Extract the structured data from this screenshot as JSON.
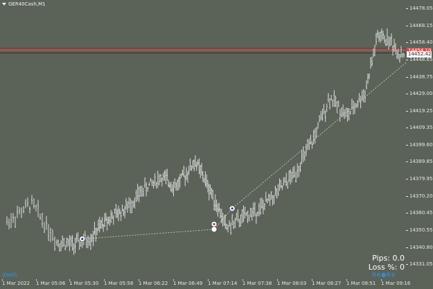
{
  "symbol": "GER40Cash,M1",
  "colors": {
    "background": "#5b6359",
    "candle": "#e9e9e9",
    "bid_line": "#aa1f1f",
    "ask_line": "#e25050",
    "current_line": "#2a2f2a",
    "trend": "#d0d6cc",
    "brand": "#2d8fe0"
  },
  "y_axis": {
    "ticks": [
      "14478.05",
      "14468.15",
      "14458.40",
      "14448.65",
      "14438.75",
      "14429.00",
      "14419.25",
      "14409.35",
      "14399.60",
      "14389.85",
      "14379.95",
      "14370.20",
      "14360.45",
      "14350.55",
      "14340.80",
      "14331.05"
    ]
  },
  "x_axis": {
    "ticks": [
      "1 Mar 2022",
      "1 Mar 05:06",
      "1 Mar 05:30",
      "1 Mar 05:58",
      "1 Mar 06:22",
      "1 Mar 06:49",
      "1 Mar 07:14",
      "1 Mar 07:38",
      "1 Mar 08:03",
      "1 Mar 08:27",
      "1 Mar 08:51",
      "1 Mar 09:16"
    ]
  },
  "price_tags": {
    "ask": "14454.10",
    "current": "14452.42"
  },
  "stats": {
    "pips": "Pips: 0.0",
    "loss": "Loss %: 0"
  },
  "brand": {
    "left": "dweb",
    "right": "Ⅲ⊕●Ⅲ⊉"
  },
  "chart_data": {
    "type": "bar",
    "title": "GER40Cash,M1",
    "ylim": [
      14331.05,
      14478.05
    ],
    "price_levels": [
      14454.1,
      14452.42
    ],
    "markers": [
      {
        "x": "1 Mar 05:24",
        "y": 14345.5
      },
      {
        "x": "1 Mar 07:04",
        "y": 14354.0
      },
      {
        "x": "1 Mar 07:04",
        "y": 14351.0
      },
      {
        "x": "1 Mar 07:18",
        "y": 14363.0
      },
      {
        "x": "1 Mar 09:23",
        "y": 14448.5
      }
    ],
    "trend_path": [
      {
        "x": "1 Mar 05:24",
        "y": 14345.5
      },
      {
        "x": "1 Mar 07:04",
        "y": 14351.0
      },
      {
        "x": "1 Mar 07:18",
        "y": 14363.0
      },
      {
        "x": "1 Mar 09:23",
        "y": 14448.5
      }
    ],
    "series": [
      {
        "x": [
          "1 Mar 2022",
          "1 Mar 05:06",
          "1 Mar 05:30",
          "1 Mar 05:58",
          "1 Mar 06:22",
          "1 Mar 06:49",
          "1 Mar 07:14",
          "1 Mar 07:38",
          "1 Mar 08:03",
          "1 Mar 08:27",
          "1 Mar 08:51",
          "1 Mar 09:16"
        ],
        "values": [
          14352,
          14345,
          14348,
          14366,
          14380,
          14388,
          14356,
          14362,
          14378,
          14415,
          14430,
          14456
        ]
      }
    ]
  }
}
